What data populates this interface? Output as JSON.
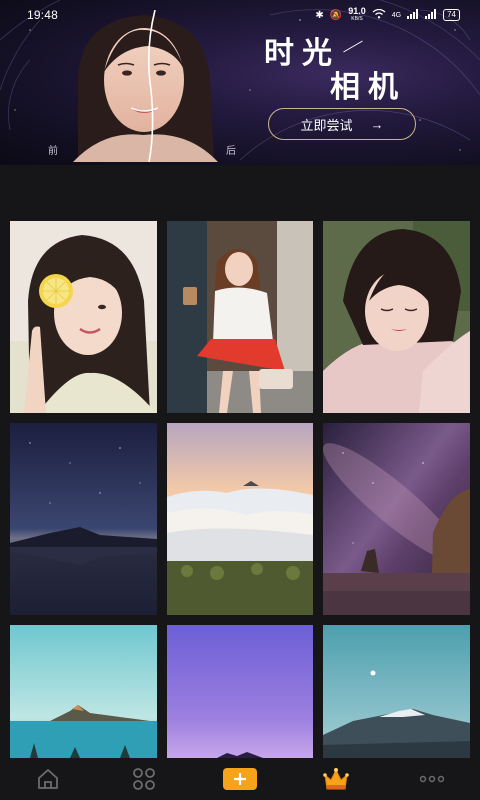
{
  "status_bar": {
    "time": "19:48",
    "net_speed": "91.0",
    "net_unit": "KB/S",
    "signal": "4G",
    "battery": "74"
  },
  "banner": {
    "title_line1": "时光",
    "title_line2": "相机",
    "try_button": "立即尝试",
    "before_label": "前",
    "after_label": "后",
    "accent_color": "#c9b58a"
  },
  "gallery": {
    "tiles": [
      {
        "name": "portrait-lemon-girl"
      },
      {
        "name": "portrait-red-skirt-girl"
      },
      {
        "name": "portrait-pink-blouse-girl"
      },
      {
        "name": "night-sky-lake"
      },
      {
        "name": "sunset-sea-of-clouds"
      },
      {
        "name": "milky-way-coast"
      },
      {
        "name": "teal-sky-island"
      },
      {
        "name": "purple-gradient-sky"
      },
      {
        "name": "snowy-mountain-moon"
      }
    ]
  },
  "bottom_nav": {
    "items": [
      "home-icon",
      "grid-apps-icon",
      "add-plus-icon",
      "crown-vip-icon",
      "more-dots-icon"
    ],
    "accent": "#f6a31a"
  }
}
